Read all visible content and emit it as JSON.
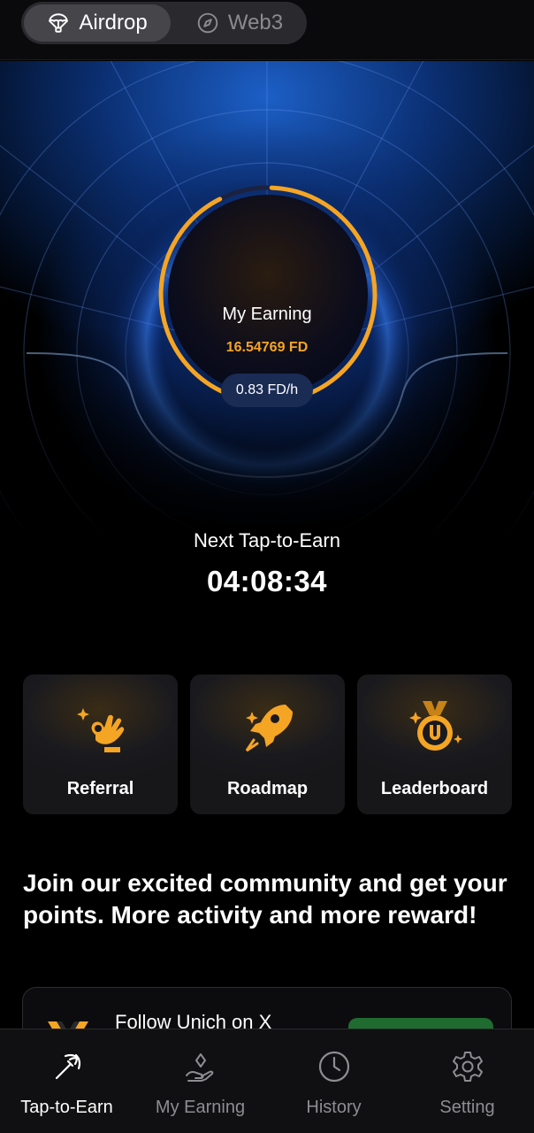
{
  "topbar": {
    "tabs": [
      {
        "label": "Airdrop",
        "icon": "parachute-icon",
        "active": true
      },
      {
        "label": "Web3",
        "icon": "compass-icon",
        "active": false
      }
    ]
  },
  "hero": {
    "earning_title": "My Earning",
    "earning_value": "16.54769 FD",
    "rate": "0.83 FD/h",
    "progress_fraction": 0.92,
    "next_label": "Next Tap-to-Earn",
    "countdown": "04:08:34"
  },
  "cards": [
    {
      "label": "Referral",
      "icon": "ok-hand-icon"
    },
    {
      "label": "Roadmap",
      "icon": "rocket-icon"
    },
    {
      "label": "Leaderboard",
      "icon": "medal-icon"
    }
  ],
  "community": {
    "text": "Join our excited community and get your points. More activity and more reward!"
  },
  "follow": {
    "text": "Follow Unich on X"
  },
  "bottom_nav": [
    {
      "label": "Tap-to-Earn",
      "icon": "pickaxe-icon",
      "active": true
    },
    {
      "label": "My Earning",
      "icon": "hand-coin-icon",
      "active": false
    },
    {
      "label": "History",
      "icon": "clock-icon",
      "active": false
    },
    {
      "label": "Setting",
      "icon": "gear-icon",
      "active": false
    }
  ],
  "colors": {
    "accent": "#f5a524",
    "active_nav": "#ffffff",
    "inactive_nav": "#8d8d92"
  }
}
